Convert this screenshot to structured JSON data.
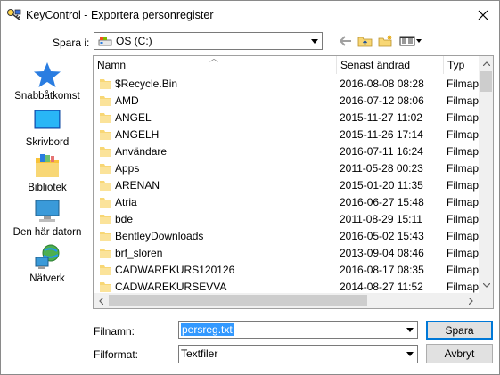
{
  "window": {
    "title": "KeyControl - Exportera personregister"
  },
  "save_in": {
    "label": "Spara i:",
    "value": "OS (C:)"
  },
  "places": [
    {
      "label": "Snabbåtkomst",
      "icon": "star-icon"
    },
    {
      "label": "Skrivbord",
      "icon": "desktop-icon"
    },
    {
      "label": "Bibliotek",
      "icon": "library-icon"
    },
    {
      "label": "Den här datorn",
      "icon": "computer-icon"
    },
    {
      "label": "Nätverk",
      "icon": "network-icon"
    }
  ],
  "columns": {
    "name": "Namn",
    "date": "Senast ändrad",
    "type": "Typ"
  },
  "files": [
    {
      "name": "$Recycle.Bin",
      "date": "2016-08-08 08:28",
      "type": "Filmapp"
    },
    {
      "name": "AMD",
      "date": "2016-07-12 08:06",
      "type": "Filmapp"
    },
    {
      "name": "ANGEL",
      "date": "2015-11-27 11:02",
      "type": "Filmapp"
    },
    {
      "name": "ANGELH",
      "date": "2015-11-26 17:14",
      "type": "Filmapp"
    },
    {
      "name": "Användare",
      "date": "2016-07-11 16:24",
      "type": "Filmapp"
    },
    {
      "name": "Apps",
      "date": "2011-05-28 00:23",
      "type": "Filmapp"
    },
    {
      "name": "ARENAN",
      "date": "2015-01-20 11:35",
      "type": "Filmapp"
    },
    {
      "name": "Atria",
      "date": "2016-06-27 15:48",
      "type": "Filmapp"
    },
    {
      "name": "bde",
      "date": "2011-08-29 15:11",
      "type": "Filmapp"
    },
    {
      "name": "BentleyDownloads",
      "date": "2016-05-02 15:43",
      "type": "Filmapp"
    },
    {
      "name": "brf_sloren",
      "date": "2013-09-04 08:46",
      "type": "Filmapp"
    },
    {
      "name": "CADWAREKURS120126",
      "date": "2016-08-17 08:35",
      "type": "Filmapp"
    },
    {
      "name": "CADWAREKURSEVVA",
      "date": "2014-08-27 11:52",
      "type": "Filmapp"
    }
  ],
  "filename": {
    "label": "Filnamn:",
    "value": "persreg.txt"
  },
  "format": {
    "label": "Filformat:",
    "value": "Textfiler"
  },
  "buttons": {
    "save": "Spara",
    "cancel": "Avbryt"
  },
  "colors": {
    "selection": "#3399ff",
    "folder": "#f8d775",
    "accent": "#0078d7"
  }
}
